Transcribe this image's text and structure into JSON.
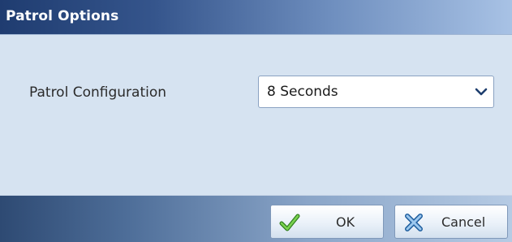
{
  "dialog": {
    "title": "Patrol Options"
  },
  "form": {
    "patrol_configuration": {
      "label": "Patrol Configuration",
      "selected": "8 Seconds"
    }
  },
  "buttons": {
    "ok_label": "OK",
    "cancel_label": "Cancel"
  },
  "icons": {
    "select_arrow": "chevron-down-icon",
    "ok": "checkmark-icon",
    "cancel": "x-icon"
  },
  "colors": {
    "title_bar_start": "#1f3c70",
    "content_background": "#d6e3f1",
    "ok_check": "#4caf2e",
    "cancel_x": "#3a82c9"
  }
}
